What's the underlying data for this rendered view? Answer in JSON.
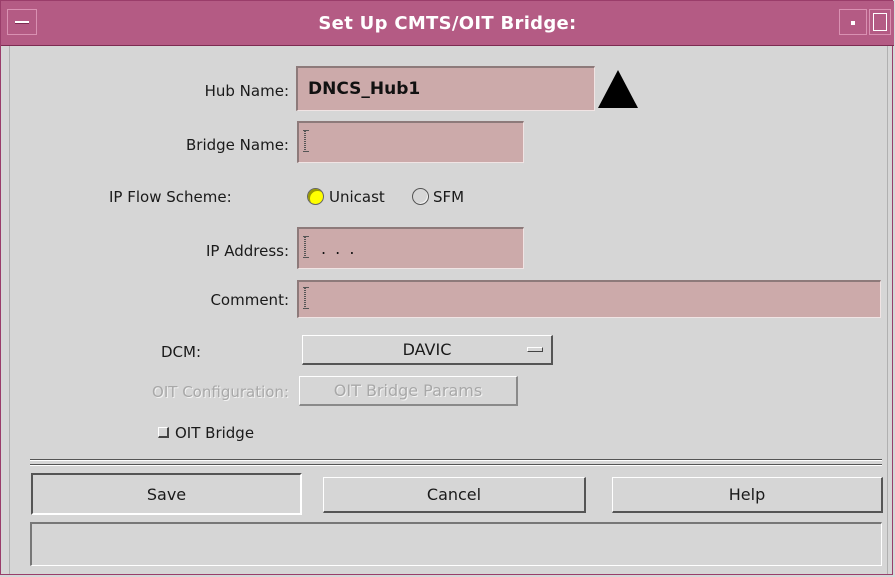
{
  "window": {
    "title": "Set Up CMTS/OIT Bridge:"
  },
  "form": {
    "hub_name": {
      "label": "Hub Name:",
      "value": "DNCS_Hub1"
    },
    "bridge_name": {
      "label": "Bridge Name:",
      "value": ""
    },
    "ip_flow_scheme": {
      "label": "IP Flow Scheme:",
      "options": [
        {
          "label": "Unicast",
          "selected": true
        },
        {
          "label": "SFM",
          "selected": false
        }
      ]
    },
    "ip_address": {
      "label": "IP Address:",
      "value": ". . ."
    },
    "comment": {
      "label": "Comment:",
      "value": ""
    },
    "dcm": {
      "label": "DCM:",
      "selected": "DAVIC"
    },
    "oit_configuration": {
      "label": "OIT Configuration:",
      "button_label": "OIT Bridge Params",
      "disabled": true
    },
    "oit_bridge": {
      "label": "OIT Bridge",
      "checked": false
    }
  },
  "actions": {
    "save_label": "Save",
    "cancel_label": "Cancel",
    "help_label": "Help"
  },
  "status_text": "",
  "icons": {
    "hub_dropdown": "triangle-up-icon",
    "window_menu": "window-menu-icon",
    "minimize": "minimize-icon",
    "maximize": "maximize-icon"
  },
  "colors": {
    "title_bar": "#b45b84",
    "field_background": "#ccaaaa",
    "radio_selected": "#ffff00",
    "window_background": "#d6d6d6"
  }
}
